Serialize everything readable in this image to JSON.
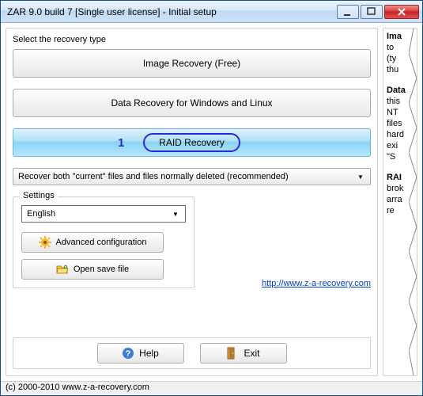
{
  "window": {
    "title": "ZAR 9.0 build 7 [Single user license] - Initial setup"
  },
  "main": {
    "select_label": "Select the recovery type",
    "buttons": {
      "image_recovery": "Image Recovery (Free)",
      "data_recovery": "Data Recovery for Windows and Linux",
      "raid_recovery": "RAID Recovery"
    },
    "annotation_number": "1",
    "mode_combo": "Recover both \"current\" files and files normally deleted (recommended)"
  },
  "settings": {
    "legend": "Settings",
    "language": "English",
    "advanced": "Advanced configuration",
    "open_save": "Open save file"
  },
  "link": {
    "text": "http://www.z-a-recovery.com",
    "href": "http://www.z-a-recovery.com"
  },
  "bottom": {
    "help": "Help",
    "exit": "Exit"
  },
  "status": "(c) 2000-2010 www.z-a-recovery.com",
  "right_panel": {
    "f1": "Ima",
    "f2": "to",
    "f3": "(ty",
    "f4": "thu",
    "f5": "Data",
    "f6": "this",
    "f7": "NT",
    "f8": "files",
    "f9": "hard",
    "f10": "exi",
    "f11": "\"S",
    "f12": "RAI",
    "f13": "brok",
    "f14": "arra",
    "f15": "re"
  }
}
